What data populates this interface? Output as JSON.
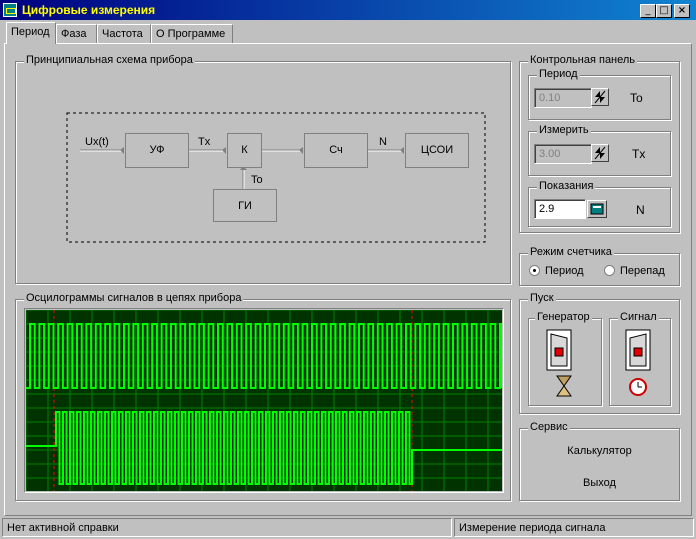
{
  "window": {
    "title": "Цифровые измерения",
    "min": "_",
    "max": "□",
    "close": "×"
  },
  "tabs": [
    "Период",
    "Фаза",
    "Частота",
    "О Программе"
  ],
  "schema": {
    "title": "Принципиальная схема прибора",
    "blocks": {
      "uf": "УФ",
      "k": "К",
      "sch": "Сч",
      "tsoi": "ЦСОИ",
      "gi": "ГИ"
    },
    "signals": {
      "ux": "Ux(t)",
      "tx": "Tx",
      "n": "N",
      "to": "To"
    }
  },
  "oscillo": {
    "title": "Осцилограммы сигналов в цепях прибора"
  },
  "control": {
    "title": "Контрольная панель",
    "period": {
      "label": "Период",
      "value": "0.10",
      "unit": "To"
    },
    "measure": {
      "label": "Измерить",
      "value": "3.00",
      "unit": "Tx"
    },
    "reading": {
      "label": "Показания",
      "value": "2.9",
      "unit": "N"
    }
  },
  "mode": {
    "title": "Режим счетчика",
    "option1": "Период",
    "option2": "Перепад",
    "selected": "Период"
  },
  "start": {
    "title": "Пуск",
    "generator": "Генератор",
    "signal": "Сигнал"
  },
  "service": {
    "title": "Сервис",
    "calc": "Калькулятор",
    "exit": "Выход"
  },
  "statusbar": {
    "left": "Нет активной справки",
    "right": "Измерение периода сигнала"
  },
  "colors": {
    "osc_bg": "#003300",
    "osc_grid": "#008000",
    "osc_trace": "#00ff00",
    "marker": "#ff0000",
    "title_text": "#ffff00"
  }
}
